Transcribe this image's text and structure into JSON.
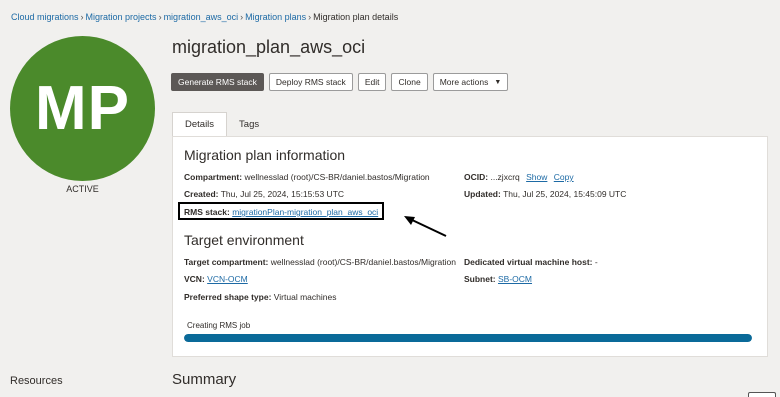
{
  "breadcrumb": {
    "items": [
      "Cloud migrations",
      "Migration projects",
      "migration_aws_oci",
      "Migration plans"
    ],
    "current": "Migration plan details"
  },
  "avatar": {
    "initials": "MP",
    "color": "#4b8a2b"
  },
  "status": "ACTIVE",
  "title": "migration_plan_aws_oci",
  "actions": {
    "generate": "Generate RMS stack",
    "deploy": "Deploy RMS stack",
    "edit": "Edit",
    "clone": "Clone",
    "more": "More actions"
  },
  "tabs": {
    "details": "Details",
    "tags": "Tags"
  },
  "plan_info": {
    "title": "Migration plan information",
    "compartment_label": "Compartment:",
    "compartment_value": "wellnesslad (root)/CS-BR/daniel.bastos/Migration",
    "ocid_label": "OCID:",
    "ocid_value": "...zjxcrq",
    "ocid_show": "Show",
    "ocid_copy": "Copy",
    "created_label": "Created:",
    "created_value": "Thu, Jul 25, 2024, 15:15:53 UTC",
    "updated_label": "Updated:",
    "updated_value": "Thu, Jul 25, 2024, 15:45:09 UTC",
    "rms_label": "RMS stack:",
    "rms_value": "migrationPlan-migration_plan_aws_oci"
  },
  "target_env": {
    "title": "Target environment",
    "compartment_label": "Target compartment:",
    "compartment_value": "wellnesslad (root)/CS-BR/daniel.bastos/Migration",
    "dvmh_label": "Dedicated virtual machine host:",
    "dvmh_value": "-",
    "vcn_label": "VCN:",
    "vcn_value": "VCN-OCM",
    "subnet_label": "Subnet:",
    "subnet_value": "SB-OCM",
    "shape_label": "Preferred shape type:",
    "shape_value": "Virtual machines"
  },
  "progress": {
    "label": "Creating RMS job",
    "percent": 100,
    "color": "#0a6a99"
  },
  "resources_title": "Resources",
  "summary_title": "Summary"
}
